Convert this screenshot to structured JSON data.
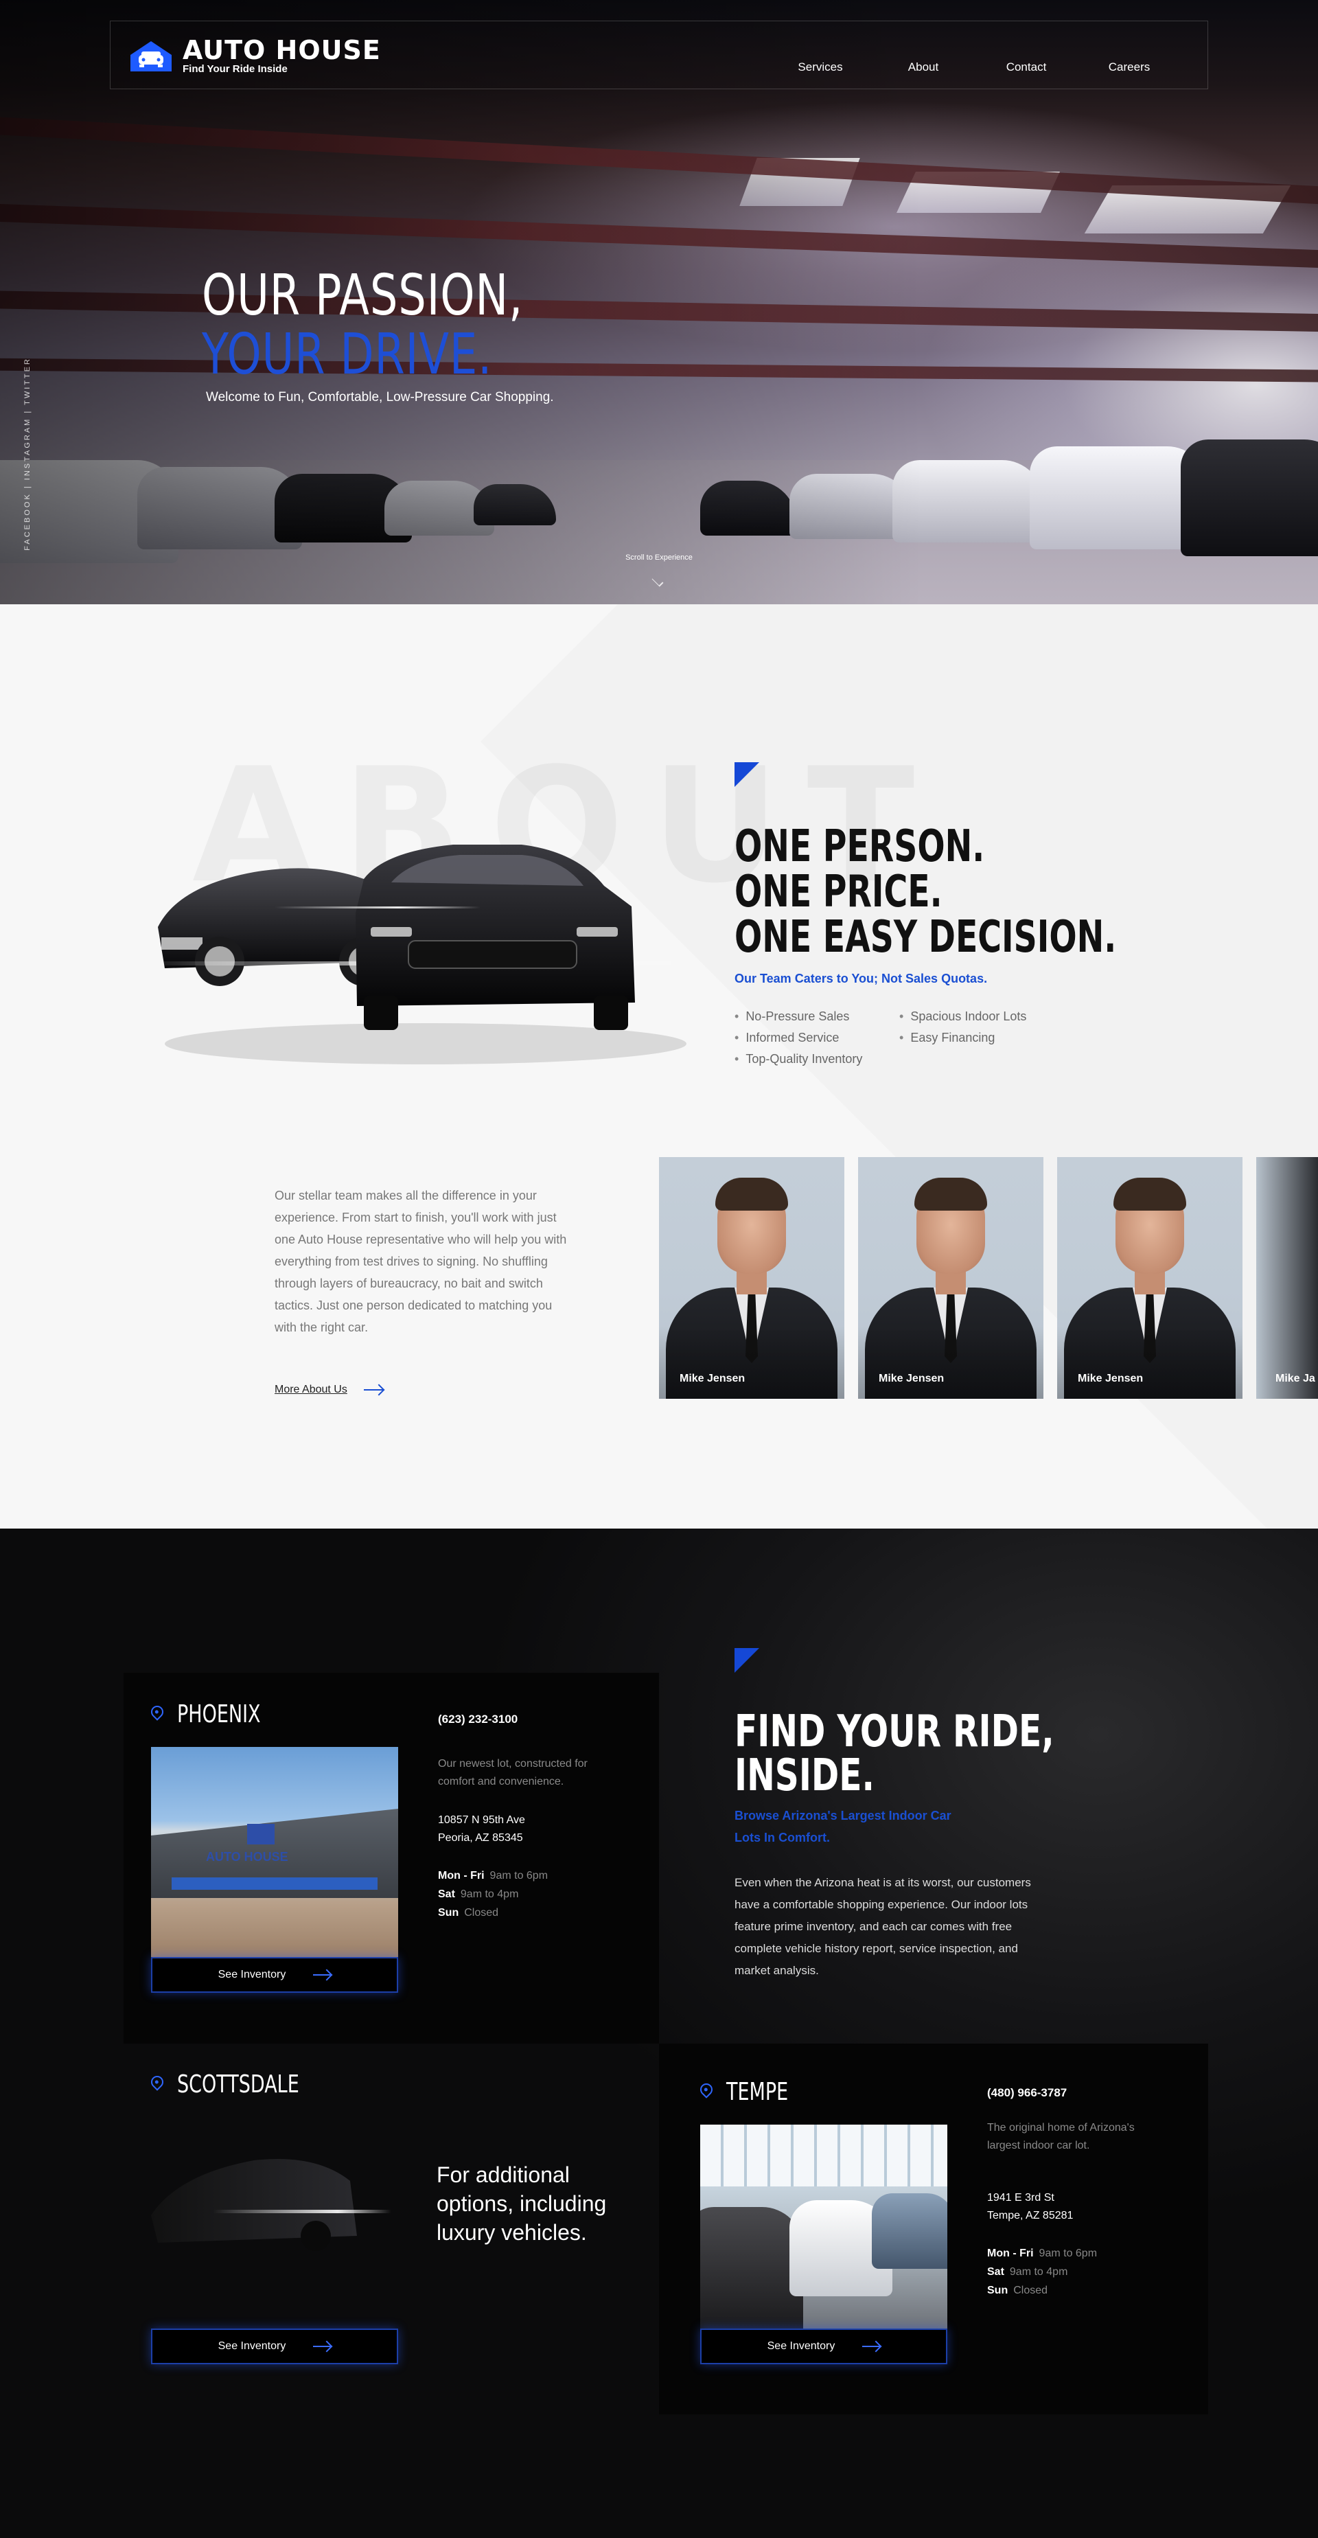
{
  "brand": {
    "title": "AUTO HOUSE",
    "subtitle": "Find Your Ride Inside"
  },
  "nav": {
    "items": [
      "Services",
      "About",
      "Contact",
      "Careers"
    ]
  },
  "hero": {
    "headline_1": "OUR PASSION,",
    "headline_2": "YOUR DRIVE.",
    "tagline": "Welcome to Fun, Comfortable, Low-Pressure Car Shopping.",
    "social": "FACEBOOK  |  INSTAGRAM  |  TWITTER",
    "scroll": "Scroll to Experience"
  },
  "about": {
    "watermark": "ABOUT",
    "headline_1": "ONE PERSON.",
    "headline_2": "ONE PRICE.",
    "headline_3": "ONE EASY DECISION.",
    "subhead": "Our Team Caters to You; Not Sales Quotas.",
    "bullets": [
      "No-Pressure Sales",
      "Spacious Indoor Lots",
      "Informed Service",
      "Easy Financing",
      "Top-Quality Inventory"
    ],
    "body": "Our stellar team makes all the difference in your experience. From start to finish, you'll work with just one Auto House representative who will help you with everything from test drives to signing. No shuffling through layers of bureaucracy, no bait and switch tactics. Just one person dedicated to matching you with the right car.",
    "more_link": "More About Us",
    "team": [
      "Mike Jensen",
      "Mike Jensen",
      "Mike Jensen",
      "Mike Ja"
    ]
  },
  "ride": {
    "headline_1": "FIND YOUR RIDE,",
    "headline_2": "INSIDE.",
    "subhead": "Browse Arizona's Largest Indoor Car Lots In Comfort.",
    "body": "Even when the Arizona heat is at its worst, our customers have a comfortable shopping experience. Our indoor lots feature prime inventory, and each car comes with free complete vehicle history report, service inspection, and market analysis.",
    "luxury_text": "For additional options, including luxury vehicles.",
    "inventory_label": "See Inventory"
  },
  "locations": {
    "phoenix": {
      "name": "PHOENIX",
      "phone": "(623) 232-3100",
      "desc": "Our newest lot, constructed for comfort and convenience.",
      "addr_1": "10857 N 95th Ave",
      "addr_2": "Peoria, AZ 85345",
      "hours_1_day": "Mon - Fri",
      "hours_1_time": "9am to 6pm",
      "hours_2_day": "Sat",
      "hours_2_time": "9am to 4pm",
      "hours_3_day": "Sun",
      "hours_3_time": "Closed",
      "sign": "AUTO HOUSE"
    },
    "scottsdale": {
      "name": "SCOTTSDALE"
    },
    "tempe": {
      "name": "TEMPE",
      "phone": "(480) 966-3787",
      "desc": "The original home of Arizona's largest indoor car lot.",
      "addr_1": "1941 E 3rd St",
      "addr_2": "Tempe, AZ 85281",
      "hours_1_day": "Mon - Fri",
      "hours_1_time": "9am to 6pm",
      "hours_2_day": "Sat",
      "hours_2_time": "9am to 4pm",
      "hours_3_day": "Sun",
      "hours_3_time": "Closed"
    }
  },
  "colors": {
    "accent": "#1a4fd2",
    "dark": "#050505",
    "light_bg": "#f7f7f7"
  },
  "icons": [
    "car-logo-icon",
    "location-pin-icon",
    "arrow-right-icon",
    "chevron-down-icon",
    "triangle-accent-icon"
  ]
}
